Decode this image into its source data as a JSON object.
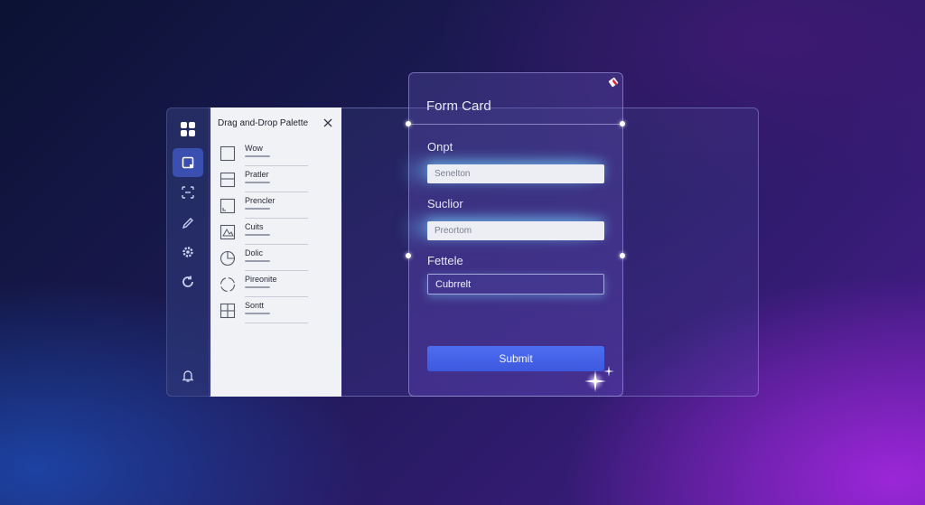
{
  "palette": {
    "title": "Drag and-Drop Palette",
    "items": [
      {
        "label": "Wow",
        "icon": "square-icon"
      },
      {
        "label": "Pratler",
        "icon": "split-rows-icon"
      },
      {
        "label": "Prencler",
        "icon": "corner-box-icon"
      },
      {
        "label": "Cuits",
        "icon": "image-icon"
      },
      {
        "label": "Dolic",
        "icon": "pie-icon"
      },
      {
        "label": "Pireonite",
        "icon": "dashed-circle-icon"
      },
      {
        "label": "Sontt",
        "icon": "grid-icon"
      }
    ]
  },
  "sidebar": {
    "items": [
      {
        "name": "grid-logo-icon"
      },
      {
        "name": "select-frame-icon",
        "active": true
      },
      {
        "name": "scan-icon"
      },
      {
        "name": "pencil-icon"
      },
      {
        "name": "gear-icon"
      },
      {
        "name": "refresh-icon"
      },
      {
        "name": "bell-icon"
      }
    ]
  },
  "form": {
    "title": "Form Card",
    "fields": [
      {
        "label": "Onpt",
        "value": "Senelton"
      },
      {
        "label": "Suclior",
        "value": "Preortom"
      },
      {
        "label": "Fettele",
        "value": "Cubrrelt"
      }
    ],
    "submit_label": "Submit"
  },
  "colors": {
    "accent": "#4a67ec",
    "sidebar_active": "#3b4fb0",
    "marker": "#d9283c"
  }
}
